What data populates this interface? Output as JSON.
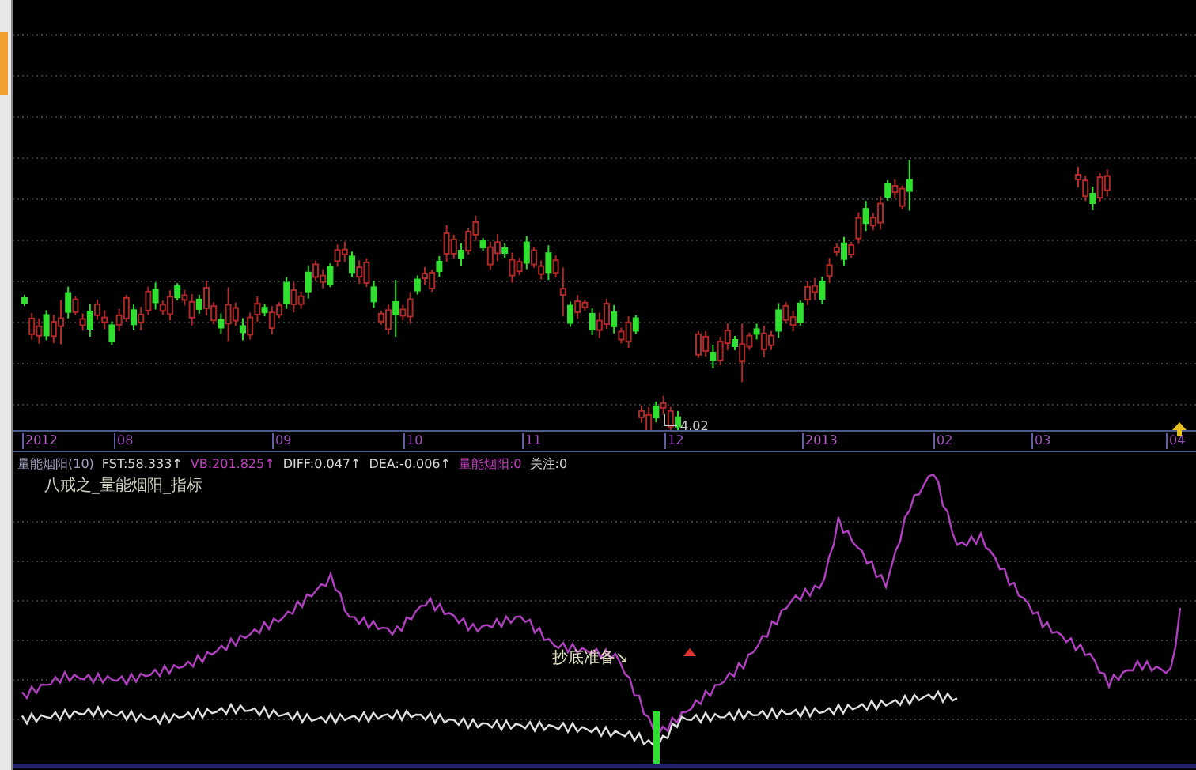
{
  "price_chart": {
    "low_label": "4.02"
  },
  "time_axis": {
    "labels": [
      {
        "text": "2012",
        "kind": "year"
      },
      {
        "text": "08",
        "kind": "month"
      },
      {
        "text": "09",
        "kind": "month"
      },
      {
        "text": "10",
        "kind": "month"
      },
      {
        "text": "11",
        "kind": "month"
      },
      {
        "text": "12",
        "kind": "month"
      },
      {
        "text": "2013",
        "kind": "year"
      },
      {
        "text": "02",
        "kind": "month"
      },
      {
        "text": "03",
        "kind": "month"
      },
      {
        "text": "04",
        "kind": "month"
      }
    ]
  },
  "indicator": {
    "name": "量能烟阳(10)",
    "readings": [
      {
        "text": "FST:58.333↑",
        "color": "#d8d8d8"
      },
      {
        "text": "VB:201.825↑",
        "color": "#c040c0"
      },
      {
        "text": "DIFF:0.047↑",
        "color": "#d8d8d8"
      },
      {
        "text": "DEA:-0.006↑",
        "color": "#d8d8d8"
      },
      {
        "text": "量能烟阳:0",
        "color": "#c040c0"
      },
      {
        "text": "关注:0",
        "color": "#d8d8d8"
      }
    ],
    "title": "八戒之_量能烟阳_指标",
    "signal_label": "抄底准备↘"
  }
}
